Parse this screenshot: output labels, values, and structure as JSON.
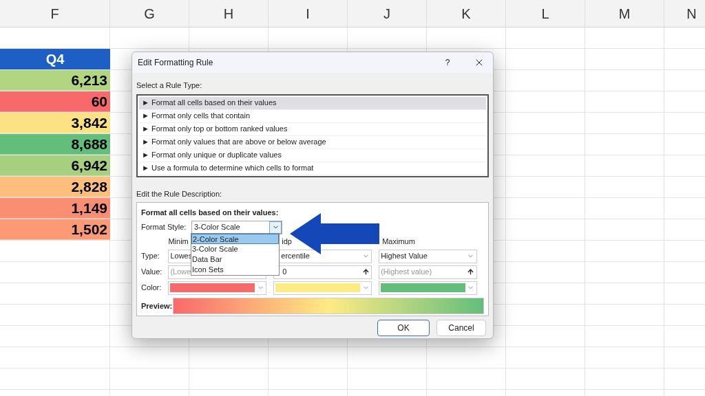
{
  "sheet": {
    "columns": [
      "F",
      "G",
      "H",
      "I",
      "J",
      "K",
      "L",
      "M",
      "N"
    ],
    "header_cell": "Q4",
    "cells": [
      {
        "value": "6,213",
        "color": "#b1d580"
      },
      {
        "value": "60",
        "color": "#f8696b"
      },
      {
        "value": "3,842",
        "color": "#fde283"
      },
      {
        "value": "8,688",
        "color": "#63be7b"
      },
      {
        "value": "6,942",
        "color": "#a6d07f"
      },
      {
        "value": "2,828",
        "color": "#fdbf7b"
      },
      {
        "value": "1,149",
        "color": "#fa8e72"
      },
      {
        "value": "1,502",
        "color": "#fb9a74"
      }
    ]
  },
  "dialog": {
    "title": "Edit Formatting Rule",
    "help": "?",
    "rule_type_label": "Select a Rule Type:",
    "rule_types": [
      {
        "label": "► Format all cells based on their values",
        "selected": true
      },
      {
        "label": "► Format only cells that contain",
        "selected": false
      },
      {
        "label": "► Format only top or bottom ranked values",
        "selected": false
      },
      {
        "label": "► Format only values that are above or below average",
        "selected": false
      },
      {
        "label": "► Format only unique or duplicate values",
        "selected": false
      },
      {
        "label": "► Use a formula to determine which cells to format",
        "selected": false
      }
    ],
    "description_label": "Edit the Rule Description:",
    "description_heading": "Format all cells based on their values:",
    "format_style_label": "Format Style:",
    "format_style_value": "3-Color Scale",
    "format_style_options": [
      {
        "label": "2-Color Scale",
        "selected": true
      },
      {
        "label": "3-Color Scale",
        "selected": false
      },
      {
        "label": "Data Bar",
        "selected": false
      },
      {
        "label": "Icon Sets",
        "selected": false
      }
    ],
    "row_labels": [
      "Type:",
      "Value:",
      "Color:"
    ],
    "columns": [
      {
        "header": "Minim",
        "type": "Lowes",
        "placeholder": "(Lowe",
        "color": "#f8696b"
      },
      {
        "header": "idp",
        "type": "ercentile",
        "value": "0",
        "color": "#ffeb84"
      },
      {
        "header": "Maximum",
        "type": "Highest Value",
        "placeholder": "(Highest value)",
        "color": "#63be7b"
      }
    ],
    "preview_label": "Preview:",
    "buttons": [
      "OK",
      "Cancel"
    ]
  }
}
